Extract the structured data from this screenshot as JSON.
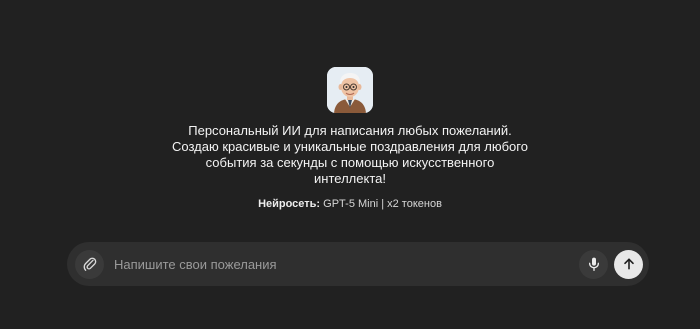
{
  "assistant": {
    "avatar_icon": "grandfather-avatar",
    "description": "Персональный ИИ для написания любых пожеланий. Создаю красивые и уникальные поздравления для любого события за секунды с помощью искусственного интеллекта!",
    "model_label": "Нейросеть:",
    "model_value": " GPT-5 Mini | x2 токенов"
  },
  "composer": {
    "placeholder": "Напишите свои пожелания",
    "value": "",
    "attach_icon": "paperclip-icon",
    "mic_icon": "microphone-icon",
    "send_icon": "arrow-up-icon"
  },
  "colors": {
    "background": "#212121",
    "composer_background": "#2f2f2f",
    "send_button": "#e8e8e8"
  }
}
